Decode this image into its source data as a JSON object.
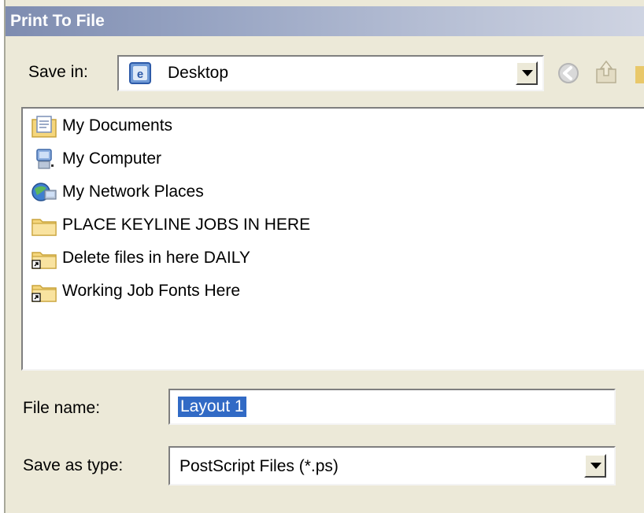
{
  "window": {
    "title": "Print To File"
  },
  "save_in": {
    "label": "Save in:",
    "value": "Desktop",
    "icon": "desktop-icon"
  },
  "toolbar": {
    "icons": [
      "back-icon",
      "up-folder-icon",
      "new-folder-icon"
    ]
  },
  "files": [
    {
      "name": "My Documents",
      "icon": "my-documents-icon"
    },
    {
      "name": "My Computer",
      "icon": "my-computer-icon"
    },
    {
      "name": "My Network Places",
      "icon": "network-places-icon"
    },
    {
      "name": "PLACE KEYLINE JOBS IN HERE",
      "icon": "folder-icon"
    },
    {
      "name": "Delete files in here DAILY",
      "icon": "folder-shortcut-icon"
    },
    {
      "name": "Working Job Fonts Here",
      "icon": "folder-shortcut-icon"
    }
  ],
  "file_name": {
    "label": "File name:",
    "value": "Layout 1"
  },
  "save_as_type": {
    "label": "Save as type:",
    "value": "PostScript Files (*.ps)"
  },
  "colors": {
    "dialog_bg": "#ece9d8",
    "selection": "#316ac5",
    "folder": "#f5d67c"
  }
}
